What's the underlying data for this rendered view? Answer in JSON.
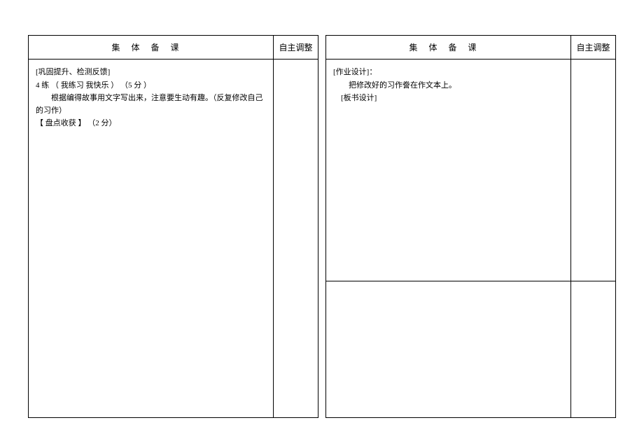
{
  "left": {
    "header_main": "集体备课",
    "header_adjust": "自主调整",
    "content": {
      "l1": "[巩固提升、检测反馈]",
      "l2": "4 练 （ 我练习 我快乐 ） （5 分 ）",
      "l3": "根据编得故事用文字写出来，注意要生动有趣。（反复修改自己的习作）",
      "l4": "【 盘点收获  】 （2 分）"
    }
  },
  "right": {
    "header_main": "集体备课",
    "header_adjust": "自主调整",
    "content_top": {
      "l1": "[作业设计]：",
      "l2": "把修改好的习作誊在作文本上。",
      "l3": "[板书设计]"
    }
  }
}
